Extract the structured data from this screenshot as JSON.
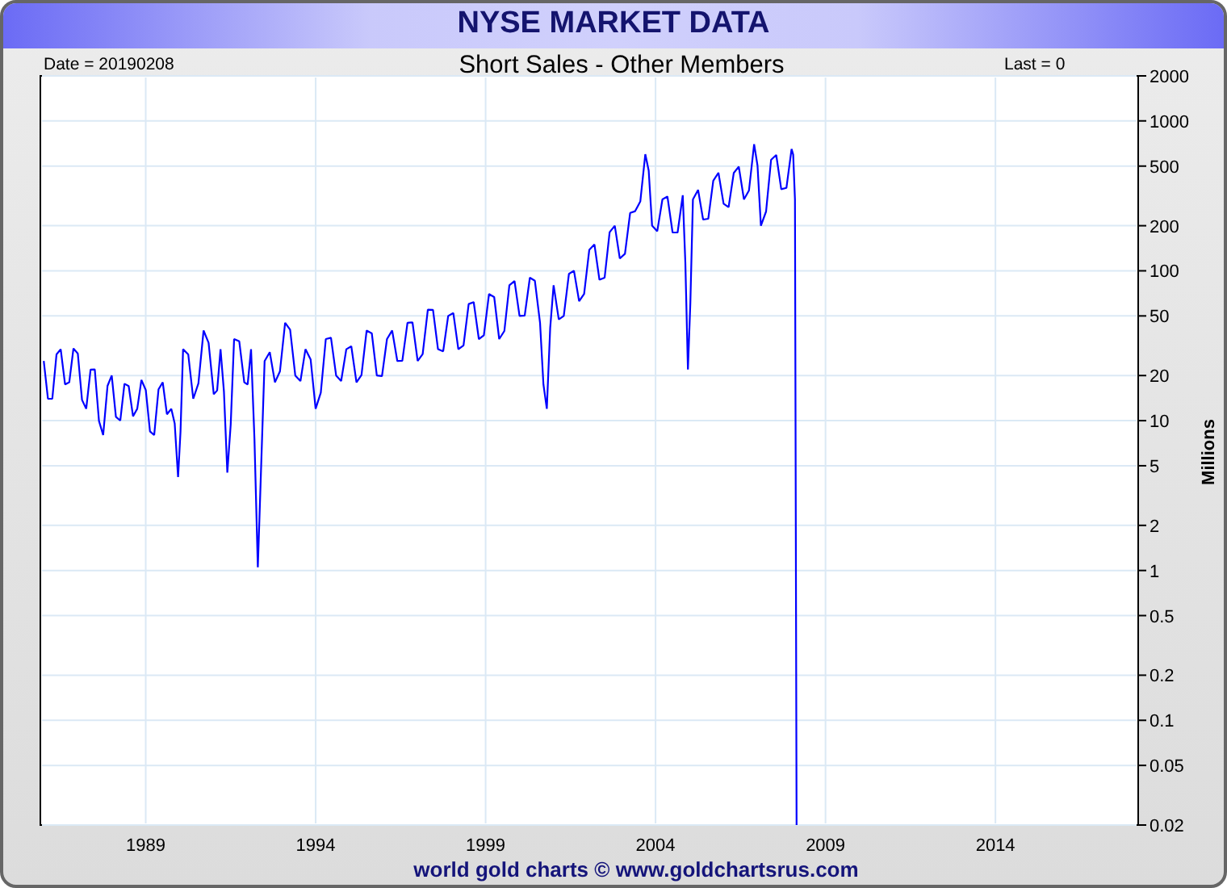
{
  "window": {
    "title": "NYSE MARKET DATA"
  },
  "header": {
    "date": "Date = 20190208",
    "last": "Last = 0"
  },
  "chart": {
    "title": "Short Sales - Other Members",
    "ylabel": "Millions",
    "x_labels": [
      "1989",
      "1994",
      "1999",
      "2004",
      "2009",
      "2014"
    ],
    "y_labels": [
      "2000",
      "1000",
      "500",
      "200",
      "100",
      "50",
      "20",
      "10",
      "5",
      "2",
      "1",
      "0.5",
      "0.2",
      "0.1",
      "0.05",
      "0.02"
    ]
  },
  "footer": {
    "credit": "world gold charts © www.goldchartsrus.com"
  }
}
